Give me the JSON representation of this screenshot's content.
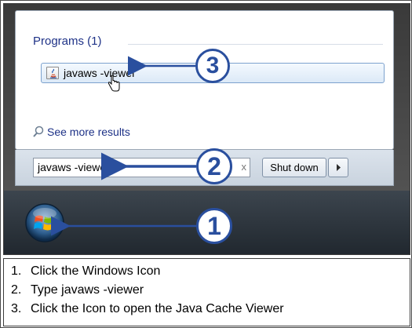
{
  "start_menu": {
    "programs_header": "Programs (1)",
    "result_item": {
      "label": "javaws -viewer",
      "icon": "java-web-start-icon"
    },
    "see_more_label": "See more results",
    "search_value": "javaws -viewer",
    "search_clear_glyph": "x",
    "shutdown_label": "Shut down",
    "shutdown_arrow_icon": "triangle-right-icon"
  },
  "taskbar": {
    "start_button_icon": "windows-orb-icon"
  },
  "callouts": [
    "1",
    "2",
    "3"
  ],
  "instructions": [
    {
      "num": "1.",
      "text": "Click the Windows Icon"
    },
    {
      "num": "2.",
      "text": "Type javaws -viewer"
    },
    {
      "num": "3.",
      "text": "Click the Icon to open the Java Cache Viewer"
    }
  ],
  "colors": {
    "link_blue": "#1e3287",
    "callout_blue": "#2a4f9e",
    "selection_border": "#7da2ce"
  }
}
